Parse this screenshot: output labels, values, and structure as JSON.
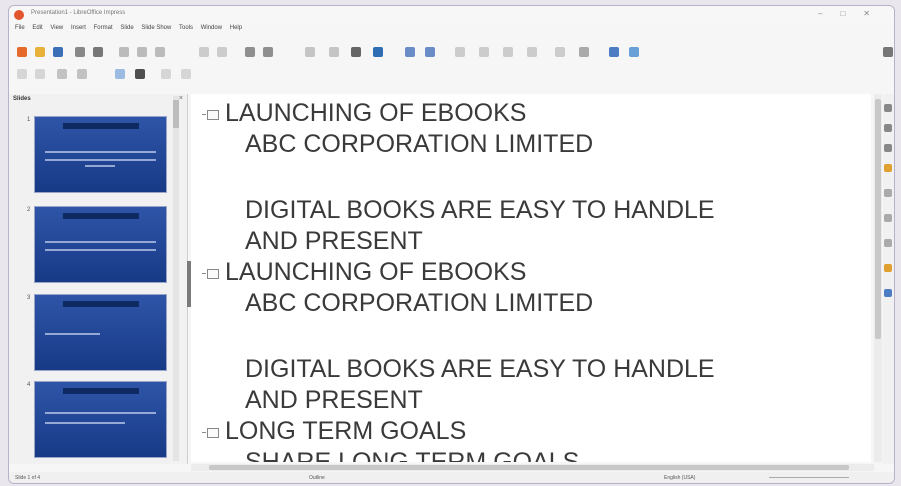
{
  "app": {
    "title": "Presentation1 - LibreOffice Impress"
  },
  "menu": [
    "File",
    "Edit",
    "View",
    "Insert",
    "Format",
    "Slide",
    "Slide Show",
    "Tools",
    "Window",
    "Help"
  ],
  "pane": {
    "title": "Slides"
  },
  "outline": [
    {
      "title": "LAUNCHING OF EBOOKS",
      "lines": [
        "ABC CORPORATION LIMITED",
        "",
        "DIGITAL BOOKS ARE EASY TO HANDLE",
        "AND PRESENT"
      ]
    },
    {
      "title": "LAUNCHING OF EBOOKS",
      "lines": [
        "ABC CORPORATION LIMITED",
        "",
        "DIGITAL BOOKS ARE EASY TO HANDLE",
        "AND PRESENT"
      ]
    },
    {
      "title": "LONG TERM GOALS",
      "lines": [
        "SHARE LONG TERM GOALS"
      ]
    }
  ],
  "thumbs": [
    "1",
    "2",
    "3",
    "4"
  ],
  "status": {
    "slide": "Slide 1 of 4",
    "layout": "Outline",
    "lang": "English (USA)"
  },
  "colors": {
    "slide_bg": "#1f47a0",
    "accent": "#e2562d"
  }
}
